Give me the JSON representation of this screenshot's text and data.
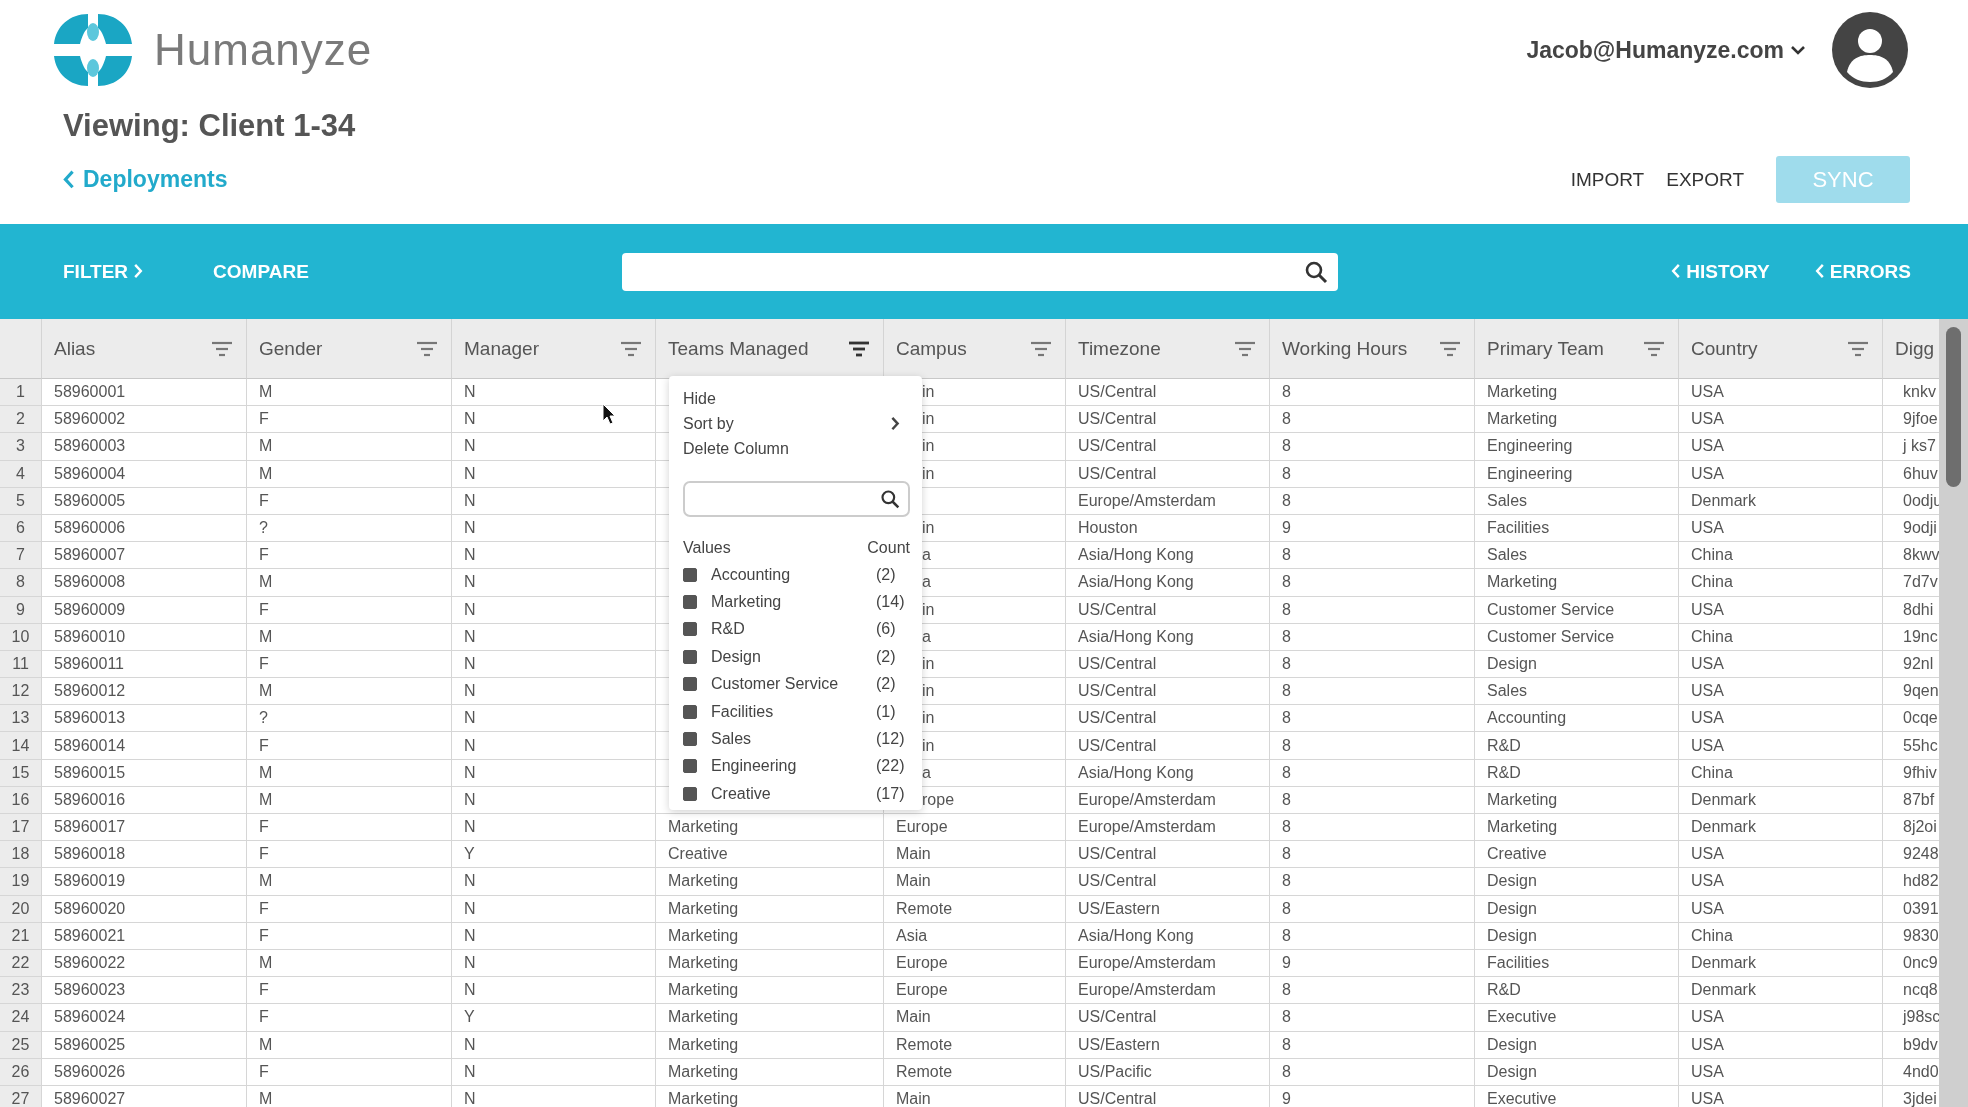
{
  "brand": {
    "name": "Humanyze"
  },
  "account": {
    "email": "Jacob@Humanyze.com"
  },
  "page": {
    "title": "Viewing: Client 1-34",
    "back_link": "Deployments"
  },
  "actions": [
    {
      "label": "IMPORT",
      "disabled": false
    },
    {
      "label": "EXPORT",
      "disabled": false
    },
    {
      "label": "SYNC",
      "disabled": true,
      "kind": "primary"
    }
  ],
  "toolbar": {
    "left": [
      {
        "label": "FILTER",
        "kind": "forward"
      },
      {
        "label": "COMPARE",
        "kind": "plain"
      }
    ],
    "right": [
      {
        "label": "HISTORY",
        "kind": "back"
      },
      {
        "label": "ERRORS",
        "kind": "back"
      }
    ]
  },
  "table": {
    "columns": [
      {
        "label": "Alias",
        "menu_open": false
      },
      {
        "label": "Gender",
        "menu_open": false
      },
      {
        "label": "Manager",
        "menu_open": false
      },
      {
        "label": "Teams Managed",
        "menu_open": true
      },
      {
        "label": "Campus",
        "menu_open": false
      },
      {
        "label": "Timezone",
        "menu_open": false
      },
      {
        "label": "Working Hours",
        "menu_open": false
      },
      {
        "label": "Primary Team",
        "menu_open": false
      },
      {
        "label": "Country",
        "menu_open": false
      },
      {
        "label": "Digg"
      }
    ],
    "rows": [
      {
        "n": "1",
        "cells": [
          "58960001",
          "M",
          "N",
          null,
          "in",
          "US/Central",
          "8",
          "Marketing",
          "USA",
          "knkv"
        ]
      },
      {
        "n": "2",
        "cells": [
          "58960002",
          "F",
          "N",
          null,
          "in",
          "US/Central",
          "8",
          "Marketing",
          "USA",
          "9jfoe"
        ]
      },
      {
        "n": "3",
        "cells": [
          "58960003",
          "M",
          "N",
          null,
          "in",
          "US/Central",
          "8",
          "Engineering",
          "USA",
          "j ks7"
        ]
      },
      {
        "n": "4",
        "cells": [
          "58960004",
          "M",
          "N",
          null,
          "in",
          "US/Central",
          "8",
          "Engineering",
          "USA",
          "6huv"
        ]
      },
      {
        "n": "5",
        "cells": [
          "58960005",
          "F",
          "N",
          null,
          null,
          "Europe/Amsterdam",
          "8",
          "Sales",
          "Denmark",
          "0odju"
        ]
      },
      {
        "n": "6",
        "cells": [
          "58960006",
          "?",
          "N",
          null,
          "in",
          "Houston",
          "9",
          "Facilities",
          "USA",
          "9odji"
        ]
      },
      {
        "n": "7",
        "cells": [
          "58960007",
          "F",
          "N",
          null,
          "a",
          "Asia/Hong Kong",
          "8",
          "Sales",
          "China",
          "8kwv"
        ]
      },
      {
        "n": "8",
        "cells": [
          "58960008",
          "M",
          "N",
          null,
          "a",
          "Asia/Hong Kong",
          "8",
          "Marketing",
          "China",
          "7d7v"
        ]
      },
      {
        "n": "9",
        "cells": [
          "58960009",
          "F",
          "N",
          null,
          "in",
          "US/Central",
          "8",
          "Customer Service",
          "USA",
          "8dhi"
        ]
      },
      {
        "n": "10",
        "cells": [
          "58960010",
          "M",
          "N",
          null,
          "a",
          "Asia/Hong Kong",
          "8",
          "Customer Service",
          "China",
          "19nc"
        ]
      },
      {
        "n": "11",
        "cells": [
          "58960011",
          "F",
          "N",
          null,
          "in",
          "US/Central",
          "8",
          "Design",
          "USA",
          "92nl"
        ]
      },
      {
        "n": "12",
        "cells": [
          "58960012",
          "M",
          "N",
          null,
          "in",
          "US/Central",
          "8",
          "Sales",
          "USA",
          "9qen"
        ]
      },
      {
        "n": "13",
        "cells": [
          "58960013",
          "?",
          "N",
          null,
          "in",
          "US/Central",
          "8",
          "Accounting",
          "USA",
          "0cqe"
        ]
      },
      {
        "n": "14",
        "cells": [
          "58960014",
          "F",
          "N",
          null,
          "in",
          "US/Central",
          "8",
          "R&D",
          "USA",
          "55hc"
        ]
      },
      {
        "n": "15",
        "cells": [
          "58960015",
          "M",
          "N",
          null,
          "a",
          "Asia/Hong Kong",
          "8",
          "R&D",
          "China",
          "9fhiv"
        ]
      },
      {
        "n": "16",
        "cells": [
          "58960016",
          "M",
          "N",
          null,
          "rope",
          "Europe/Amsterdam",
          "8",
          "Marketing",
          "Denmark",
          "87bf"
        ]
      },
      {
        "n": "17",
        "cells": [
          "58960017",
          "F",
          "N",
          "Marketing",
          "Europe",
          "Europe/Amsterdam",
          "8",
          "Marketing",
          "Denmark",
          "8j2oi"
        ]
      },
      {
        "n": "18",
        "cells": [
          "58960018",
          "F",
          "Y",
          "Creative",
          "Main",
          "US/Central",
          "8",
          "Creative",
          "USA",
          "9248"
        ]
      },
      {
        "n": "19",
        "cells": [
          "58960019",
          "M",
          "N",
          "Marketing",
          "Main",
          "US/Central",
          "8",
          "Design",
          "USA",
          "hd82"
        ]
      },
      {
        "n": "20",
        "cells": [
          "58960020",
          "F",
          "N",
          "Marketing",
          "Remote",
          "US/Eastern",
          "8",
          "Design",
          "USA",
          "0391"
        ]
      },
      {
        "n": "21",
        "cells": [
          "58960021",
          "F",
          "N",
          "Marketing",
          "Asia",
          "Asia/Hong Kong",
          "8",
          "Design",
          "China",
          "9830"
        ]
      },
      {
        "n": "22",
        "cells": [
          "58960022",
          "M",
          "N",
          "Marketing",
          "Europe",
          "Europe/Amsterdam",
          "9",
          "Facilities",
          "Denmark",
          "0nc9"
        ]
      },
      {
        "n": "23",
        "cells": [
          "58960023",
          "F",
          "N",
          "Marketing",
          "Europe",
          "Europe/Amsterdam",
          "8",
          "R&D",
          "Denmark",
          "ncq8"
        ]
      },
      {
        "n": "24",
        "cells": [
          "58960024",
          "F",
          "Y",
          "Marketing",
          "Main",
          "US/Central",
          "8",
          "Executive",
          "USA",
          "j98sc"
        ]
      },
      {
        "n": "25",
        "cells": [
          "58960025",
          "M",
          "N",
          "Marketing",
          "Remote",
          "US/Eastern",
          "8",
          "Design",
          "USA",
          "b9dv"
        ]
      },
      {
        "n": "26",
        "cells": [
          "58960026",
          "F",
          "N",
          "Marketing",
          "Remote",
          "US/Pacific",
          "8",
          "Design",
          "USA",
          "4nd0"
        ]
      },
      {
        "n": "27",
        "cells": [
          "58960027",
          "M",
          "N",
          "Marketing",
          "Main",
          "US/Central",
          "9",
          "Executive",
          "USA",
          "3jdei"
        ]
      }
    ]
  },
  "column_menu": {
    "items": [
      {
        "label": "Hide",
        "submenu": false
      },
      {
        "label": "Sort by",
        "submenu": true
      },
      {
        "label": "Delete Column",
        "submenu": false
      }
    ],
    "values_heading": "Values",
    "count_heading": "Count",
    "values": [
      {
        "label": "Accounting",
        "count": "(2)",
        "checked": true
      },
      {
        "label": "Marketing",
        "count": "(14)",
        "checked": true
      },
      {
        "label": "R&D",
        "count": "(6)",
        "checked": true
      },
      {
        "label": "Design",
        "count": "(2)",
        "checked": true
      },
      {
        "label": "Customer Service",
        "count": "(2)",
        "checked": true
      },
      {
        "label": "Facilities",
        "count": "(1)",
        "checked": true
      },
      {
        "label": "Sales",
        "count": "(12)",
        "checked": true
      },
      {
        "label": "Engineering",
        "count": "(22)",
        "checked": true
      },
      {
        "label": "Creative",
        "count": "(17)",
        "checked": true
      }
    ]
  }
}
